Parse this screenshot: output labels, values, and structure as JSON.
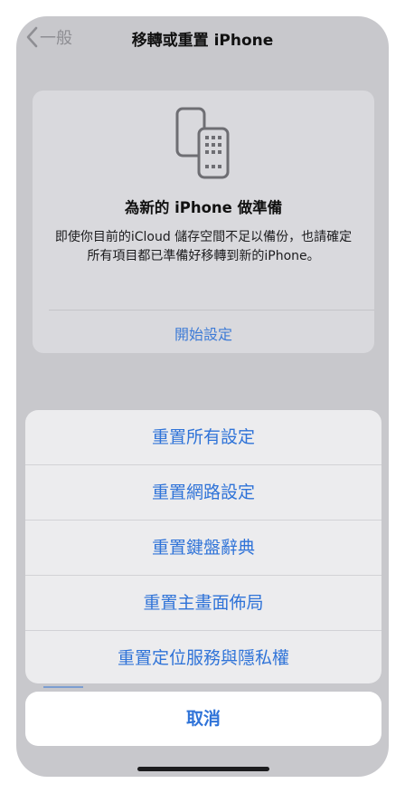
{
  "navbar": {
    "back_label": "一般",
    "title": "移轉或重置 iPhone"
  },
  "prepare_card": {
    "icon": "iphone-transfer-icon",
    "title": "為新的 iPhone 做準備",
    "body": "即使你目前的iCloud 儲存空間不足以備份，也請確定所有項目都已準備好移轉到新的iPhone。",
    "action_label": "開始設定"
  },
  "reset_sheet": {
    "items": [
      {
        "label": "重置所有設定"
      },
      {
        "label": "重置網路設定"
      },
      {
        "label": "重置鍵盤辭典"
      },
      {
        "label": "重置主畫面佈局"
      },
      {
        "label": "重置定位服務與隱私權"
      }
    ],
    "cancel_label": "取消"
  },
  "colors": {
    "accent": "#2f73d8",
    "dim_background": "#c8c8cc",
    "sheet_background": "#ececee"
  }
}
